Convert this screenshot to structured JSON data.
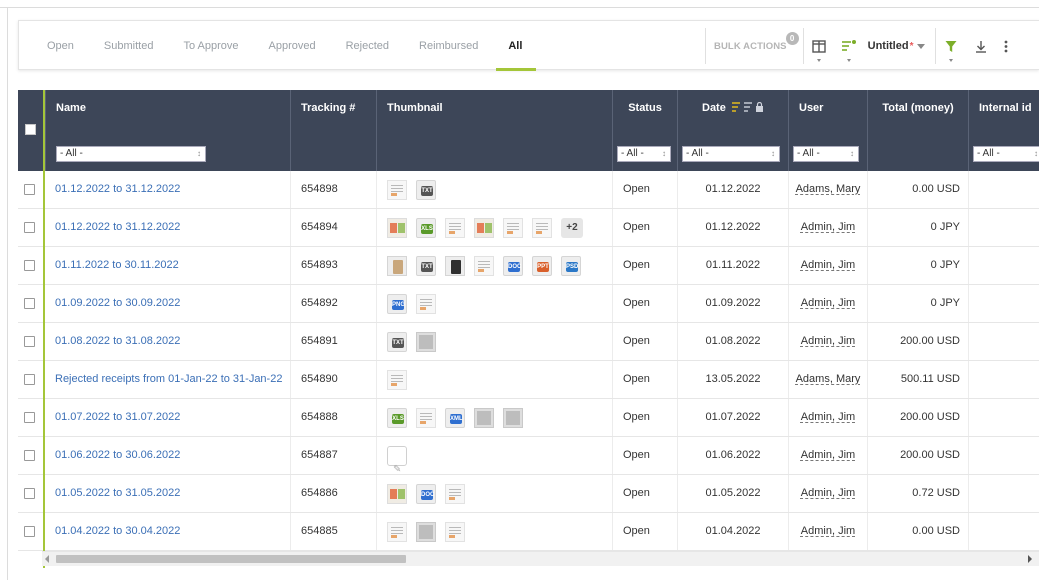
{
  "tabs": [
    {
      "label": "Open",
      "active": false
    },
    {
      "label": "Submitted",
      "active": false
    },
    {
      "label": "To Approve",
      "active": false
    },
    {
      "label": "Approved",
      "active": false
    },
    {
      "label": "Rejected",
      "active": false
    },
    {
      "label": "Reimbursed",
      "active": false
    },
    {
      "label": "All",
      "active": true
    }
  ],
  "toolbar": {
    "bulk_actions": "BULK ACTIONS",
    "bulk_count": "0",
    "view_name": "Untitled",
    "view_modified_mark": "*",
    "icons": [
      "columns-icon",
      "sort-icon",
      "filter-icon",
      "download-icon",
      "more-icon"
    ]
  },
  "columns": [
    {
      "title": "Name",
      "filter": "- All -"
    },
    {
      "title": "Tracking #",
      "filter": ""
    },
    {
      "title": "Thumbnail",
      "filter": ""
    },
    {
      "title": "Status",
      "filter": "- All -"
    },
    {
      "title": "Date",
      "filter": "- All -"
    },
    {
      "title": "User",
      "filter": "- All -"
    },
    {
      "title": "Total (money)",
      "filter": ""
    },
    {
      "title": "Internal id",
      "filter": "- All -"
    }
  ],
  "rows": [
    {
      "name": "01.12.2022 to 31.12.2022",
      "tracking": "654898",
      "status": "Open",
      "date": "01.12.2022",
      "user": "Adams, Mary",
      "total": "0.00 USD",
      "thumbs": [
        "doc",
        "badge:TXT"
      ]
    },
    {
      "name": "01.12.2022 to 31.12.2022",
      "tracking": "654894",
      "status": "Open",
      "date": "01.12.2022",
      "user": "Admin, Jim",
      "total": "0 JPY",
      "thumbs": [
        "colorful",
        "badge:XLS",
        "doc",
        "colorful",
        "doc",
        "doc",
        "more:+2"
      ]
    },
    {
      "name": "01.11.2022 to 30.11.2022",
      "tracking": "654893",
      "status": "Open",
      "date": "01.11.2022",
      "user": "Admin, Jim",
      "total": "0 JPY",
      "thumbs": [
        "tan",
        "badge:TXT",
        "dark",
        "doc",
        "badge:DOC",
        "badge:PPT",
        "badge:PSD"
      ]
    },
    {
      "name": "01.09.2022 to 30.09.2022",
      "tracking": "654892",
      "status": "Open",
      "date": "01.09.2022",
      "user": "Admin, Jim",
      "total": "0 JPY",
      "thumbs": [
        "badge:PNG",
        "doc"
      ]
    },
    {
      "name": "01.08.2022 to 31.08.2022",
      "tracking": "654891",
      "status": "Open",
      "date": "01.08.2022",
      "user": "Admin, Jim",
      "total": "200.00 USD",
      "thumbs": [
        "badge:TXT",
        "photo"
      ]
    },
    {
      "name": "Rejected receipts from 01-Jan-22 to 31-Jan-22",
      "tracking": "654890",
      "status": "Open",
      "date": "13.05.2022",
      "user": "Adams, Mary",
      "total": "500.11 USD",
      "thumbs": [
        "doc"
      ]
    },
    {
      "name": "01.07.2022 to 31.07.2022",
      "tracking": "654888",
      "status": "Open",
      "date": "01.07.2022",
      "user": "Admin, Jim",
      "total": "200.00 USD",
      "thumbs": [
        "badge:XLS",
        "doc",
        "badge:XML",
        "photo",
        "photo"
      ]
    },
    {
      "name": "01.06.2022 to 30.06.2022",
      "tracking": "654887",
      "status": "Open",
      "date": "01.06.2022",
      "user": "Admin, Jim",
      "total": "200.00 USD",
      "thumbs": [
        "plain"
      ]
    },
    {
      "name": "01.05.2022 to 31.05.2022",
      "tracking": "654886",
      "status": "Open",
      "date": "01.05.2022",
      "user": "Admin, Jim",
      "total": "0.72 USD",
      "thumbs": [
        "colorful",
        "badge:DOC",
        "doc"
      ]
    },
    {
      "name": "01.04.2022 to 30.04.2022",
      "tracking": "654885",
      "status": "Open",
      "date": "01.04.2022",
      "user": "Admin, Jim",
      "total": "0.00 USD",
      "thumbs": [
        "doc",
        "photo",
        "doc"
      ]
    }
  ],
  "colors": {
    "header_bg": "#3d4658",
    "accent_green": "#a4c639",
    "link_blue": "#3b6fb6"
  }
}
